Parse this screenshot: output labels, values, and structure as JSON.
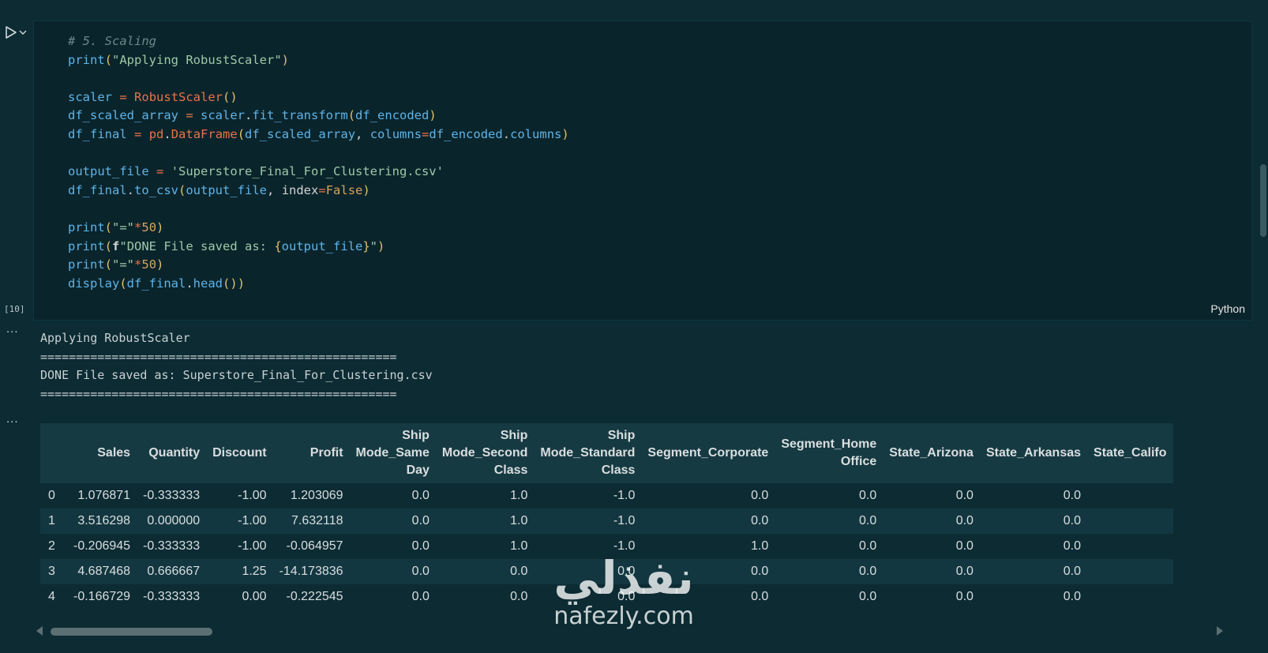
{
  "cell": {
    "execution_count": "[10]",
    "language": "Python",
    "code_lines": [
      "# 5. Scaling",
      "print(\"Applying RobustScaler\")",
      "",
      "scaler = RobustScaler()",
      "df_scaled_array = scaler.fit_transform(df_encoded)",
      "df_final = pd.DataFrame(df_scaled_array, columns=df_encoded.columns)",
      "",
      "output_file = 'Superstore_Final_For_Clustering.csv'",
      "df_final.to_csv(output_file, index=False)",
      "",
      "print(\"=\"*50)",
      "print(f\"DONE File saved as: {output_file}\")",
      "print(\"=\"*50)",
      "display(df_final.head())"
    ]
  },
  "output": {
    "ellipsis": "...",
    "lines": [
      "Applying RobustScaler",
      "==================================================",
      "DONE File saved as: Superstore_Final_For_Clustering.csv",
      "=================================================="
    ]
  },
  "table": {
    "columns": [
      [
        "Sales"
      ],
      [
        "Quantity"
      ],
      [
        "Discount"
      ],
      [
        "Profit"
      ],
      [
        "Ship",
        "Mode_Same",
        "Day"
      ],
      [
        "Ship",
        "Mode_Second",
        "Class"
      ],
      [
        "Ship",
        "Mode_Standard",
        "Class"
      ],
      [
        "Segment_Corporate"
      ],
      [
        "Segment_Home",
        "Office"
      ],
      [
        "State_Arizona"
      ],
      [
        "State_Arkansas"
      ],
      [
        "State_Califo"
      ]
    ],
    "rows": [
      [
        "0",
        "1.076871",
        "-0.333333",
        "-1.00",
        "1.203069",
        "0.0",
        "1.0",
        "-1.0",
        "0.0",
        "0.0",
        "0.0",
        "0.0",
        ""
      ],
      [
        "1",
        "3.516298",
        "0.000000",
        "-1.00",
        "7.632118",
        "0.0",
        "1.0",
        "-1.0",
        "0.0",
        "0.0",
        "0.0",
        "0.0",
        ""
      ],
      [
        "2",
        "-0.206945",
        "-0.333333",
        "-1.00",
        "-0.064957",
        "0.0",
        "1.0",
        "-1.0",
        "1.0",
        "0.0",
        "0.0",
        "0.0",
        ""
      ],
      [
        "3",
        "4.687468",
        "0.666667",
        "1.25",
        "-14.173836",
        "0.0",
        "0.0",
        "0.0",
        "0.0",
        "0.0",
        "0.0",
        "0.0",
        ""
      ],
      [
        "4",
        "-0.166729",
        "-0.333333",
        "0.00",
        "-0.222545",
        "0.0",
        "0.0",
        "0.0",
        "0.0",
        "0.0",
        "0.0",
        "0.0",
        ""
      ]
    ]
  },
  "watermark": {
    "arabic": "نفذلي",
    "latin": "nafezly.com"
  },
  "icons": {
    "run": "run-cell-icon",
    "chevron": "chevron-down-icon"
  }
}
